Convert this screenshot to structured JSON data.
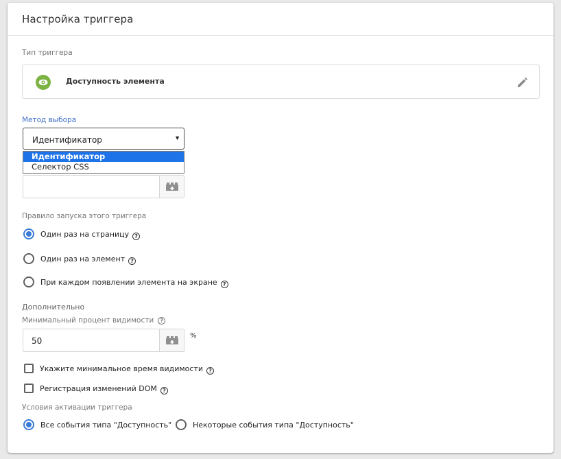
{
  "card": {
    "title": "Настройка триггера"
  },
  "trigger_type": {
    "section_label": "Тип триггера",
    "name": "Доступность элемента",
    "icon": "eye-icon",
    "icon_color": "#7cb342"
  },
  "selection_method": {
    "label": "Метод выбора",
    "selected": "Идентификатор",
    "options": [
      "Идентификатор",
      "Селектор CSS"
    ],
    "highlight_color": "#1e73e8"
  },
  "element_id_input": {
    "value": ""
  },
  "fire_rule": {
    "label": "Правило запуска этого триггера",
    "options": [
      {
        "label": "Один раз на страницу",
        "checked": true
      },
      {
        "label": "Один раз на элемент",
        "checked": false
      },
      {
        "label": "При каждом появлении элемента на экране",
        "checked": false
      }
    ]
  },
  "advanced": {
    "heading": "Дополнительно",
    "min_visibility_label": "Минимальный процент видимости",
    "min_visibility_value": "50",
    "percent_sign": "%",
    "checkboxes": [
      {
        "label": "Укажите минимальное время видимости",
        "checked": false
      },
      {
        "label": "Регистрация изменений DOM",
        "checked": false
      }
    ]
  },
  "activation": {
    "label": "Условия активации триггера",
    "options": [
      {
        "label": "Все события типа \"Доступность\"",
        "checked": true
      },
      {
        "label": "Некоторые события типа \"Доступность\"",
        "checked": false
      }
    ]
  },
  "help_glyph": "?",
  "accent_color": "#3a7bd5"
}
